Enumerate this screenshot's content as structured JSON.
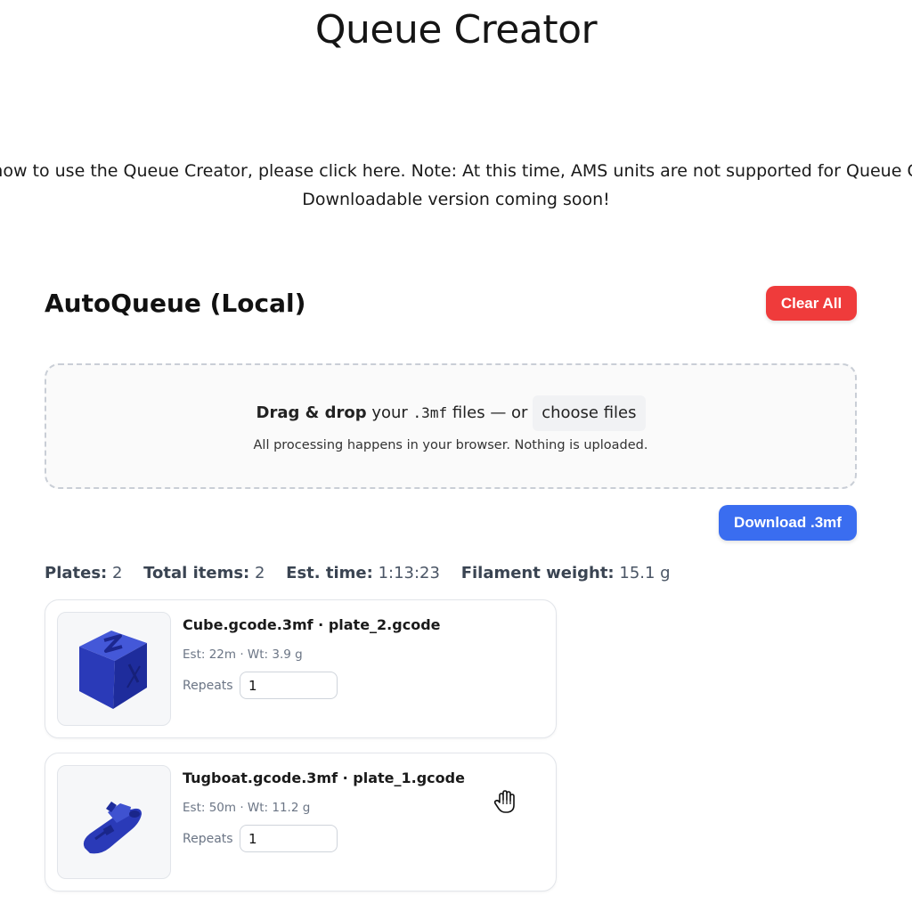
{
  "page": {
    "title": "Queue Creator",
    "notice_line1": "n how to use the Queue Creator, please click here. Note: At this time, AMS units are not supported for Queue Cre",
    "notice_line2": "Downloadable version coming soon!"
  },
  "autoqueue": {
    "title": "AutoQueue (Local)",
    "clear_label": "Clear All",
    "download_label": "Download .3mf",
    "colors": {
      "clear": "#ef3b3b",
      "download": "#3a6df0",
      "model": "#2b3fc9"
    }
  },
  "dropzone": {
    "bold": "Drag & drop",
    "text1": "your",
    "ext": ".3mf",
    "text2": "files — or",
    "choose_label": "choose files",
    "note": "All processing happens in your browser. Nothing is uploaded."
  },
  "stats": {
    "plates_label": "Plates:",
    "plates_value": "2",
    "items_label": "Total items:",
    "items_value": "2",
    "time_label": "Est. time:",
    "time_value": "1:13:23",
    "weight_label": "Filament weight:",
    "weight_value": "15.1 g"
  },
  "plates": [
    {
      "name": "Cube.gcode.3mf · plate_2.gcode",
      "meta": "Est: 22m · Wt: 3.9 g",
      "repeats_label": "Repeats",
      "repeats_value": "1",
      "thumb_icon": "cube-model-icon"
    },
    {
      "name": "Tugboat.gcode.3mf · plate_1.gcode",
      "meta": "Est: 50m · Wt: 11.2 g",
      "repeats_label": "Repeats",
      "repeats_value": "1",
      "thumb_icon": "tugboat-model-icon"
    }
  ]
}
